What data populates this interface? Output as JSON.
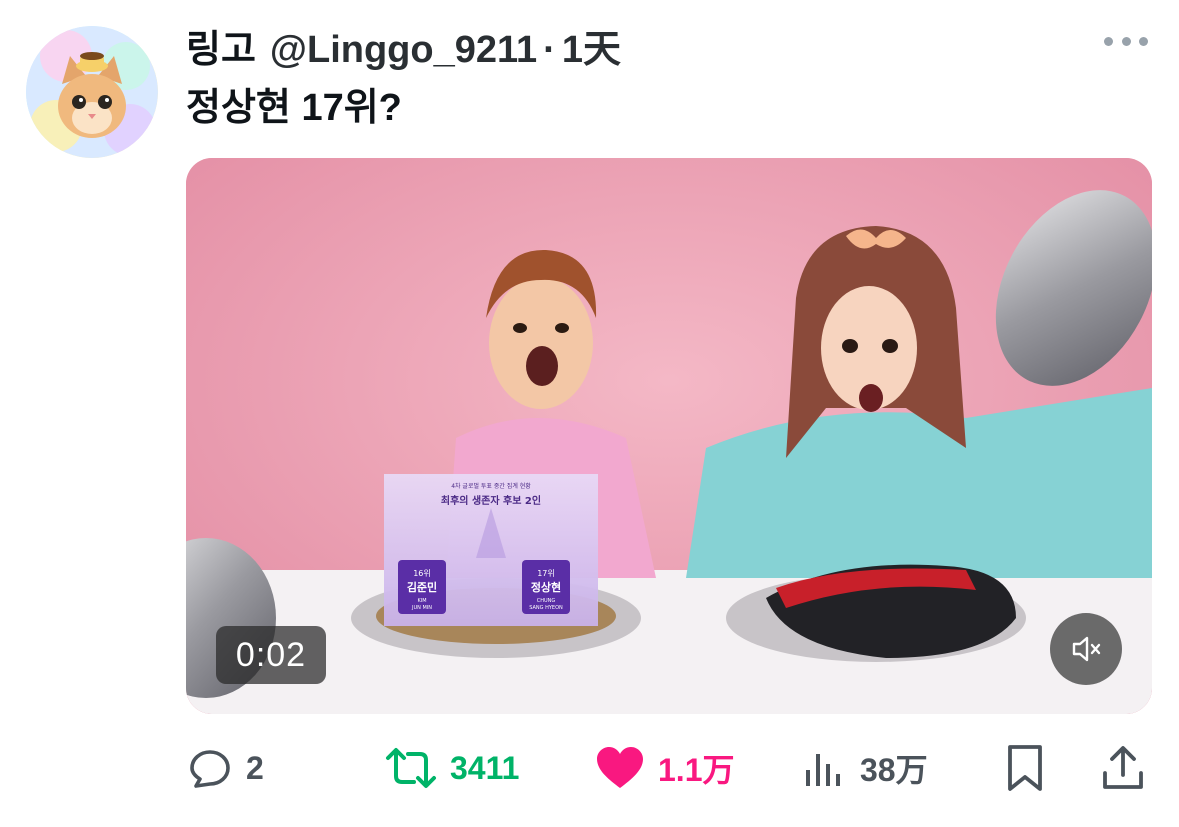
{
  "tweet": {
    "display_name": "링고",
    "handle": "@Linggo_9211",
    "separator": "·",
    "time": "1天",
    "text": "정상현 17위?"
  },
  "video": {
    "timestamp": "0:02",
    "overlay": {
      "header_small": "4차 글로벌 투표 중간 집계 현황",
      "header": "최후의 생존자 후보 2인",
      "left_rank": "16위",
      "left_name": "김준민",
      "left_romanized_1": "KIM",
      "left_romanized_2": "JUN MIN",
      "right_rank": "17위",
      "right_name": "정상현",
      "right_romanized_1": "CHUNG",
      "right_romanized_2": "SANG HYEON"
    }
  },
  "actions": {
    "replies": "2",
    "retweets": "3411",
    "likes": "1.1万",
    "views": "38万"
  },
  "colors": {
    "retweet": "#00b368",
    "like": "#f91880",
    "muted_text": "#4b535b"
  },
  "icons": [
    "reply-icon",
    "retweet-icon",
    "heart-icon",
    "views-icon",
    "bookmark-icon",
    "share-icon",
    "more-icon",
    "mute-icon"
  ]
}
